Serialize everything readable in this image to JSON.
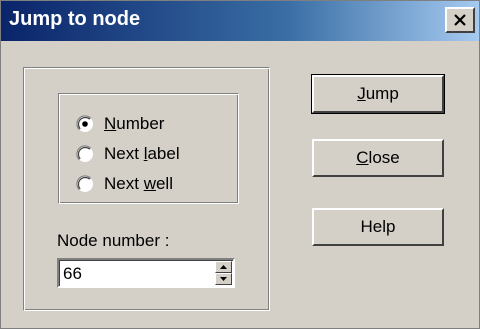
{
  "window": {
    "title": "Jump to node",
    "close_glyph": "×"
  },
  "mode": {
    "options": [
      {
        "pre": "",
        "key": "N",
        "post": "umber",
        "selected": true
      },
      {
        "pre": "Next ",
        "key": "l",
        "post": "abel",
        "selected": false
      },
      {
        "pre": "Next ",
        "key": "w",
        "post": "ell",
        "selected": false
      }
    ]
  },
  "node_number": {
    "label": "Node number :",
    "value": "66"
  },
  "buttons": {
    "jump": {
      "key": "J",
      "rest": "ump"
    },
    "close": {
      "key": "C",
      "rest": "lose"
    },
    "help": {
      "label": "Help"
    }
  },
  "icons": {
    "close": "close-icon",
    "spin_up": "triangle-up-icon",
    "spin_down": "triangle-down-icon",
    "radio_selected": "radio-selected-icon",
    "radio_unselected": "radio-unselected-icon"
  }
}
